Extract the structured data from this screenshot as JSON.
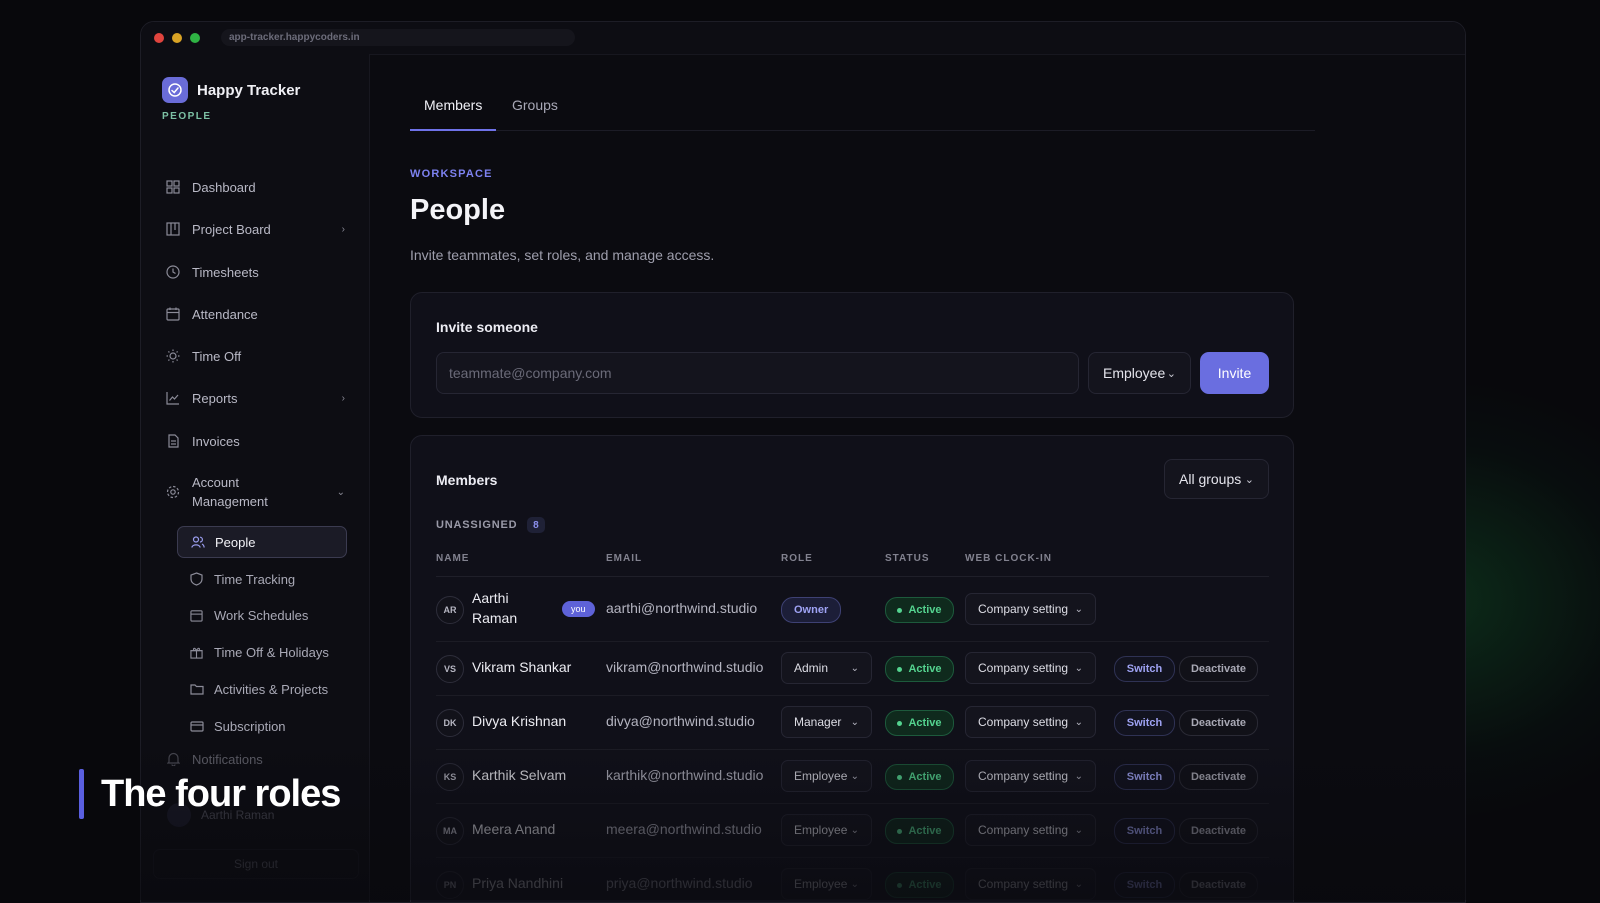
{
  "browser": {
    "url": "app-tracker.happycoders.in"
  },
  "brand": {
    "name": "Happy Tracker",
    "section": "PEOPLE"
  },
  "sidebar": {
    "items": [
      {
        "label": "Dashboard"
      },
      {
        "label": "Project Board"
      },
      {
        "label": "Timesheets"
      },
      {
        "label": "Attendance"
      },
      {
        "label": "Time Off"
      },
      {
        "label": "Reports"
      },
      {
        "label": "Invoices"
      },
      {
        "label": "Account Management"
      }
    ],
    "sub_items": [
      {
        "label": "People"
      },
      {
        "label": "Time Tracking"
      },
      {
        "label": "Work Schedules"
      },
      {
        "label": "Time Off & Holidays"
      },
      {
        "label": "Activities & Projects"
      },
      {
        "label": "Subscription"
      }
    ],
    "notifications_label": "Notifications",
    "user_name": "Aarthi Raman",
    "sign_out": "Sign out"
  },
  "tabs": [
    {
      "label": "Members"
    },
    {
      "label": "Groups"
    }
  ],
  "page": {
    "eyebrow": "WORKSPACE",
    "title": "People",
    "subtitle": "Invite teammates, set roles, and manage access."
  },
  "invite": {
    "title": "Invite someone",
    "placeholder": "teammate@company.com",
    "role": "Employee",
    "button": "Invite"
  },
  "members": {
    "title": "Members",
    "filter": "All groups",
    "group_label": "UNASSIGNED",
    "group_count": "8",
    "columns": {
      "name": "NAME",
      "email": "EMAIL",
      "role": "ROLE",
      "status": "STATUS",
      "clock": "WEB CLOCK-IN"
    },
    "rows": [
      {
        "initials": "AR",
        "name": "Aarthi Raman",
        "you": "you",
        "email": "aarthi@northwind.studio",
        "role": "Owner",
        "status": "Active",
        "clock": "Company setting"
      },
      {
        "initials": "VS",
        "name": "Vikram Shankar",
        "email": "vikram@northwind.studio",
        "role": "Admin",
        "status": "Active",
        "clock": "Company setting",
        "switch": "Switch",
        "deactivate": "Deactivate"
      },
      {
        "initials": "DK",
        "name": "Divya Krishnan",
        "email": "divya@northwind.studio",
        "role": "Manager",
        "status": "Active",
        "clock": "Company setting",
        "switch": "Switch",
        "deactivate": "Deactivate"
      },
      {
        "initials": "KS",
        "name": "Karthik Selvam",
        "email": "karthik@northwind.studio",
        "role": "Employee",
        "status": "Active",
        "clock": "Company setting",
        "switch": "Switch",
        "deactivate": "Deactivate"
      },
      {
        "initials": "MA",
        "name": "Meera Anand",
        "email": "meera@northwind.studio",
        "role": "Employee",
        "status": "Active",
        "clock": "Company setting",
        "switch": "Switch",
        "deactivate": "Deactivate"
      },
      {
        "initials": "PN",
        "name": "Priya Nandhini",
        "email": "priya@northwind.studio",
        "role": "Employee",
        "status": "Active",
        "clock": "Company setting",
        "switch": "Switch",
        "deactivate": "Deactivate"
      }
    ]
  },
  "caption": "The four roles",
  "colors": {
    "accent": "#6a6ee0",
    "active_green": "#54d38f",
    "brand_teal": "#7cc0a4"
  }
}
